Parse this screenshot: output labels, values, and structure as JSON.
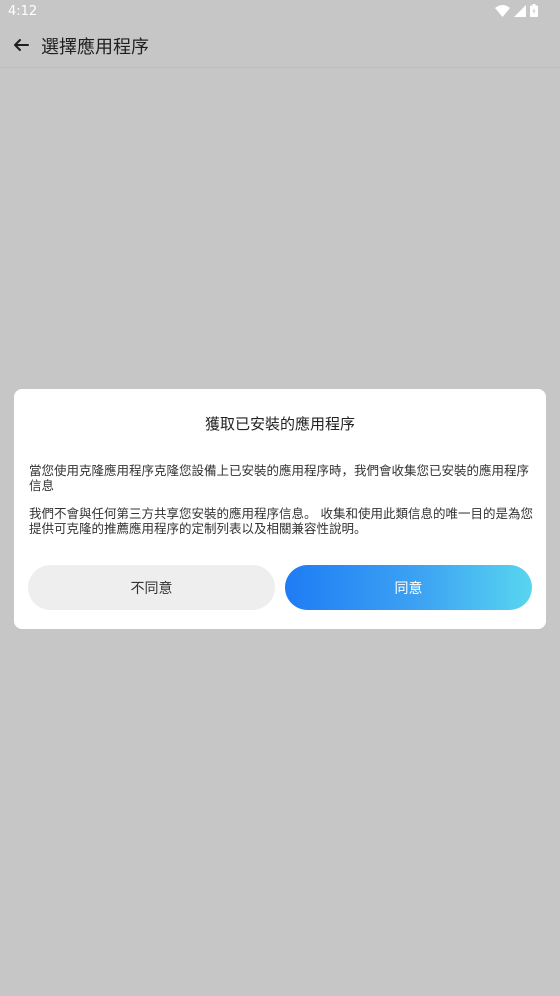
{
  "status": {
    "time": "4:12"
  },
  "appbar": {
    "title": "選擇應用程序"
  },
  "dialog": {
    "title": "獲取已安裝的應用程序",
    "paragraph1": "當您使用克隆應用程序克隆您設備上已安裝的應用程序時，我們會收集您已安裝的應用程序信息",
    "paragraph2": "我們不會與任何第三方共享您安裝的應用程序信息。 收集和使用此類信息的唯一目的是為您提供可克隆的推薦應用程序的定制列表以及相關兼容性說明。",
    "disagree_label": "不同意",
    "agree_label": "同意"
  },
  "colors": {
    "background": "#c6c6c6",
    "agree_gradient_start": "#1f7cf5",
    "agree_gradient_end": "#58d6f0"
  }
}
